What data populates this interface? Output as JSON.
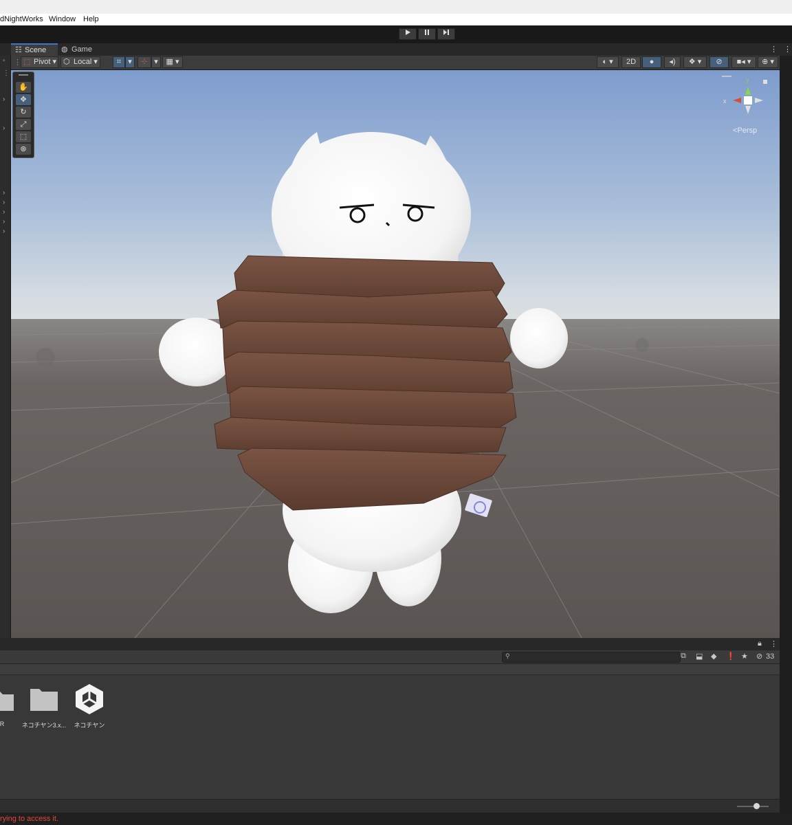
{
  "menu": {
    "items": [
      "dNightWorks",
      "Window",
      "Help"
    ]
  },
  "toolbar": {
    "play_icon": "play-icon",
    "pause_icon": "pause-icon",
    "step_icon": "step-icon"
  },
  "tabs": {
    "scene": "Scene",
    "game": "Game"
  },
  "scene_toolbar": {
    "pivot": "Pivot",
    "local": "Local",
    "mode_2d": "2D"
  },
  "gizmo": {
    "x": "x",
    "y": "y",
    "persp": "Persp"
  },
  "project": {
    "hidden_count": "33",
    "assets": [
      {
        "label": "R",
        "icon": "folder-icon"
      },
      {
        "label": "ネコチヤン3.x...",
        "icon": "folder-icon"
      },
      {
        "label": "ネコチヤン",
        "icon": "unity-prefab-icon"
      }
    ]
  },
  "status": {
    "message": "rying to access it.",
    "color": "#e04a3c"
  },
  "colors": {
    "accent": "#46607c",
    "sky_top": "#7f9dcf",
    "ground": "#5e5a57",
    "wrap_brown": "#6e4c3c"
  }
}
